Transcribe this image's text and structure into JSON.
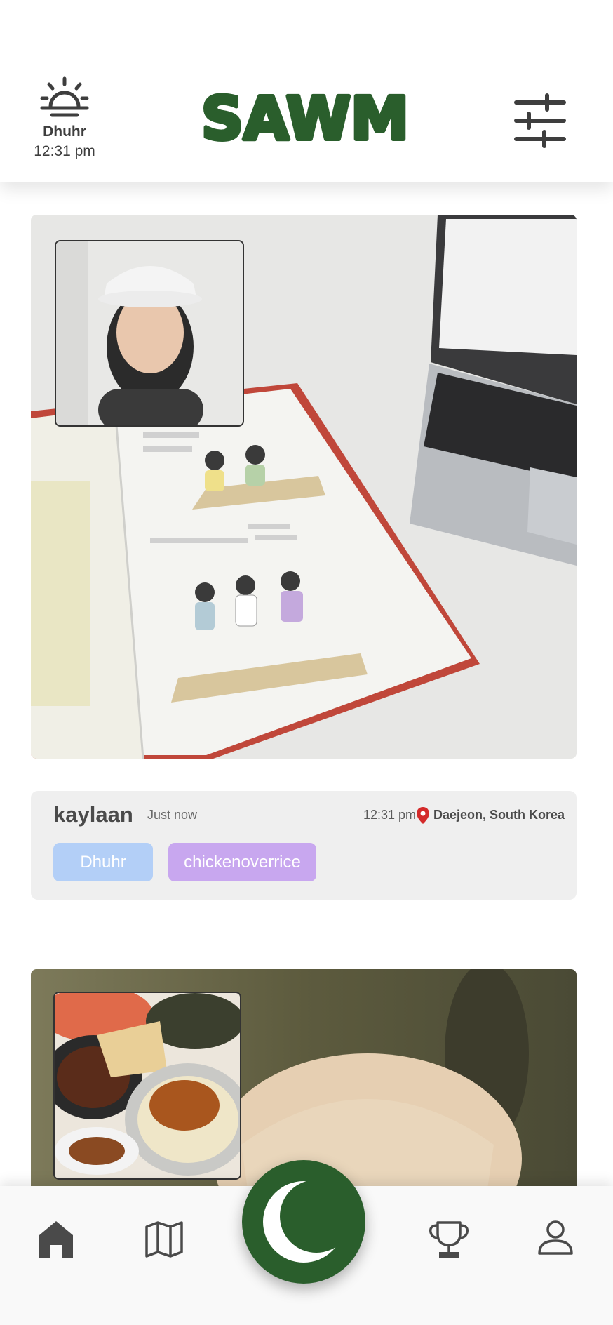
{
  "app": {
    "logo_text": "SAWM"
  },
  "header": {
    "prayer_name": "Dhuhr",
    "prayer_time": "12:31 pm",
    "prayer_icon": "sunrise-icon",
    "settings_icon": "sliders-icon"
  },
  "posts": [
    {
      "username": "kaylaan",
      "posted_ago": "Just now",
      "time": "12:31 pm",
      "location": "Daejeon, South Korea",
      "tags": [
        "Dhuhr",
        "chickenoverrice"
      ]
    }
  ],
  "nav": {
    "items": [
      "home-icon",
      "map-icon",
      "crescent-icon",
      "trophy-icon",
      "profile-icon"
    ]
  },
  "colors": {
    "brand_green": "#2a5e2c",
    "tag_prayer": "#b3cff7",
    "tag_meal": "#c8a7ef",
    "location_pin": "#d42a2a"
  }
}
